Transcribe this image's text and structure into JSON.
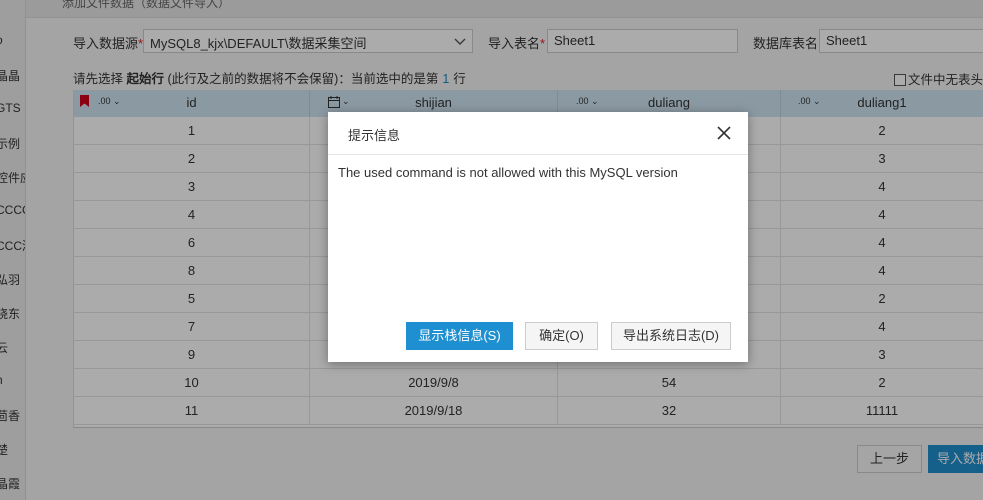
{
  "sidebar": {
    "items": [
      "o",
      "晶晶",
      "GTS",
      "示例",
      "控件应",
      "CCCC",
      "CCC测",
      "弘羽",
      "晓东",
      "云",
      "n",
      "茴香",
      "楚",
      "晶霞"
    ]
  },
  "topbar": {
    "title": "添加文件数据（数据文件导入）"
  },
  "form": {
    "source_label": "导入数据源",
    "source_value": "MySQL8_kjx\\DEFAULT\\数据采集空间",
    "table_label": "导入表名",
    "table_value": "Sheet1",
    "db_table_label": "数据库表名",
    "db_table_value": "Sheet1",
    "required_mark": "*"
  },
  "hint": {
    "prefix": "请先选择",
    "bold": "起始行",
    "middle": "(此行及之前的数据将不会保留)：当前选中的是第",
    "row_number": "1",
    "suffix": "行"
  },
  "no_header_label": "文件中无表头",
  "table": {
    "columns": [
      {
        "name": "id",
        "type_label": ".00"
      },
      {
        "name": "shijian",
        "type_label": ""
      },
      {
        "name": "duliang",
        "type_label": ".00"
      },
      {
        "name": "duliang1",
        "type_label": ".00"
      }
    ],
    "rows": [
      [
        "1",
        "",
        "",
        "2"
      ],
      [
        "2",
        "",
        "",
        "3"
      ],
      [
        "3",
        "",
        "",
        "4"
      ],
      [
        "4",
        "",
        "",
        "4"
      ],
      [
        "6",
        "",
        "",
        "4"
      ],
      [
        "8",
        "",
        "",
        "4"
      ],
      [
        "5",
        "",
        "",
        "2"
      ],
      [
        "7",
        "",
        "",
        "4"
      ],
      [
        "9",
        "",
        "",
        "3"
      ],
      [
        "10",
        "2019/9/8",
        "54",
        "2"
      ],
      [
        "11",
        "2019/9/18",
        "32",
        "11111"
      ]
    ]
  },
  "bottom": {
    "prev_label": "上一步",
    "import_label": "导入数据"
  },
  "dialog": {
    "title": "提示信息",
    "message": "The used command is not allowed with this MySQL version",
    "show_stack_label": "显示栈信息(S)",
    "ok_label": "确定(O)",
    "export_log_label": "导出系统日志(D)"
  },
  "colors": {
    "accent": "#1e8fd0",
    "header_bg": "#cfe5f4",
    "flag": "#d0021b"
  }
}
